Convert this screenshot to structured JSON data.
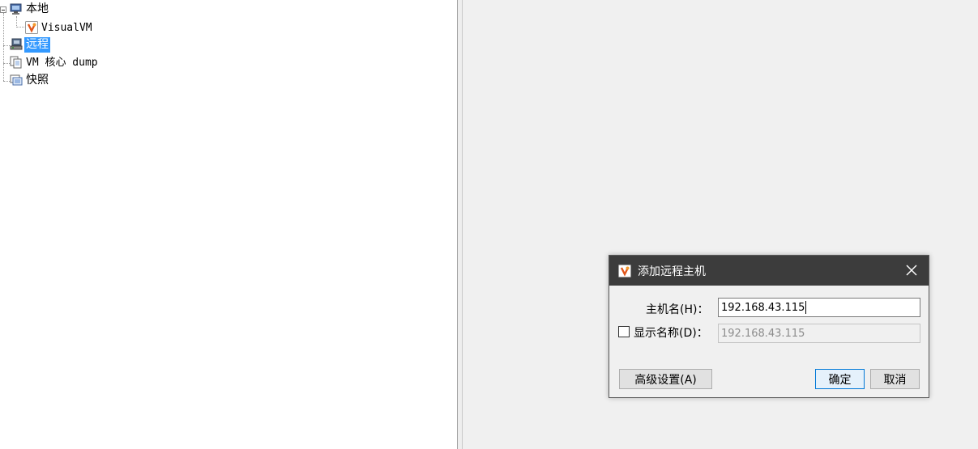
{
  "tree": {
    "local_label": "本地",
    "visualvm_label": "VisualVM",
    "remote_label": "远程",
    "coredump_label": "VM 核心 dump",
    "snapshot_label": "快照"
  },
  "dialog": {
    "title": "添加远程主机",
    "host_label": "主机名(H)：",
    "host_value": "192.168.43.115",
    "display_name_label": "显示名称(D)：",
    "display_name_value": "192.168.43.115",
    "advanced_button": "高级设置(A)",
    "ok_button": "确定",
    "cancel_button": "取消"
  },
  "colors": {
    "selection": "#3399ff",
    "titlebar": "#3c3c3c",
    "default_button_border": "#0078d7"
  },
  "icons": {
    "local": "monitor-icon",
    "visualvm": "visualvm-app-icon",
    "remote": "remote-host-icon",
    "coredump": "core-dump-icon",
    "snapshot": "snapshot-icon",
    "close": "close-icon"
  }
}
